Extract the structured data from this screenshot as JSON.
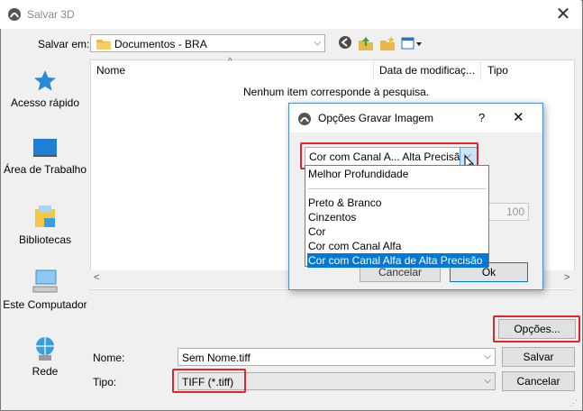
{
  "window": {
    "title": "Salvar 3D",
    "close": "✕"
  },
  "toolbar": {
    "save_in_label": "Salvar em:",
    "folder_value": "Documentos - BRA"
  },
  "sidebar": {
    "items": [
      {
        "label": "Acesso rápido",
        "icon": "star-icon"
      },
      {
        "label": "Área de Trabalho",
        "icon": "desktop-icon"
      },
      {
        "label": "Bibliotecas",
        "icon": "libraries-icon"
      },
      {
        "label": "Este Computador",
        "icon": "computer-icon"
      },
      {
        "label": "Rede",
        "icon": "network-icon"
      }
    ]
  },
  "filelist": {
    "columns": [
      "Nome",
      "Data de modificaç...",
      "Tipo"
    ],
    "empty_message": "Nenhum item corresponde à pesquisa."
  },
  "form": {
    "name_label": "Nome:",
    "name_value": "Sem Nome.tiff",
    "type_label": "Tipo:",
    "type_value": "TIFF (*.tiff)",
    "save_button": "Salvar",
    "cancel_button": "Cancelar",
    "options_button": "Opções..."
  },
  "dialog": {
    "title": "Opções Gravar Imagem",
    "help": "?",
    "close": "✕",
    "selected": "Cor com Canal A... Alta Precisão",
    "options": [
      "Melhor Profundidade",
      "Preto & Branco",
      "Cinzentos",
      "Cor",
      "Cor com Canal Alfa",
      "Cor com Canal Alfa de Alta Precisão"
    ],
    "partial_value": "100",
    "cancel_button": "Cancelar",
    "ok_button": "Ok"
  },
  "colors": {
    "accent": "#0078d7",
    "highlight_red": "#e0252b"
  }
}
